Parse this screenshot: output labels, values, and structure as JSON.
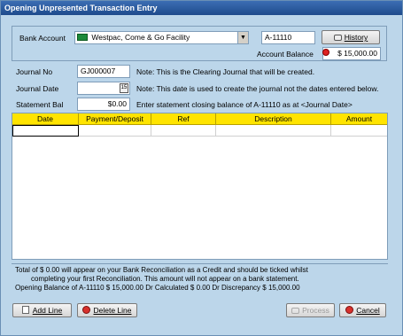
{
  "window": {
    "title": "Opening Unpresented Transaction Entry"
  },
  "bank": {
    "label": "Bank Account",
    "value": "Westpac, Come & Go Facility",
    "code": "A-11110",
    "history_label": "History",
    "balance_label": "Account Balance",
    "balance_value": "$ 15,000.00"
  },
  "journal": {
    "no_label": "Journal No",
    "no_value": "GJ000007",
    "no_note": "Note: This is the Clearing Journal that will be created.",
    "date_label": "Journal Date",
    "date_value": "",
    "date_note": "Note: This date is used to create the journal not the dates entered below.",
    "stmt_label": "Statement Bal",
    "stmt_value": "$0.00",
    "stmt_note": "Enter statement closing balance of A-11110 as at  <Journal Date>"
  },
  "grid": {
    "headers": [
      "Date",
      "Payment/Deposit",
      "Ref",
      "Description",
      "Amount"
    ]
  },
  "info": {
    "line1": "Total of $ 0.00 will appear on your Bank Reconciliation as a Credit and should be ticked whilst",
    "line2": "completing your first Reconciliation. This amount will not appear on a bank statement.",
    "line3": "Opening Balance of A-11110 $ 15,000.00 Dr Calculated $ 0.00 Dr Discrepancy $ 15,000.00"
  },
  "buttons": {
    "add_line": "Add Line",
    "delete_line": "Delete Line",
    "process": "Process",
    "cancel": "Cancel"
  },
  "colors": {
    "grid_header": "#ffe400",
    "window_bg": "#bcd6ea",
    "title_bar": "#1e4b8c"
  }
}
